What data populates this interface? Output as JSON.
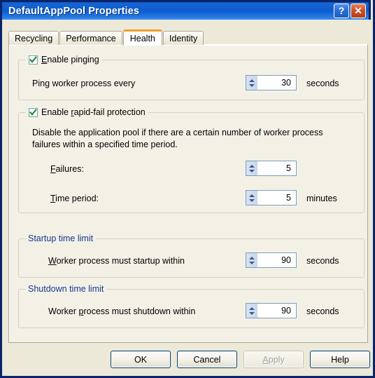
{
  "window": {
    "title": "DefaultAppPool Properties",
    "help_button": "?",
    "close_button": "✕"
  },
  "tabs": [
    {
      "label": "Recycling",
      "selected": false
    },
    {
      "label": "Performance",
      "selected": false
    },
    {
      "label": "Health",
      "selected": true
    },
    {
      "label": "Identity",
      "selected": false
    }
  ],
  "health": {
    "pinging": {
      "checkbox_label_pre": "E",
      "checkbox_label_accel": "E",
      "checkbox_label": "Enable pinging",
      "checked": true,
      "row_label": "Ping worker process every",
      "value": "30",
      "unit": "seconds"
    },
    "rapid_fail": {
      "checkbox_label": "Enable rapid-fail protection",
      "checked": true,
      "description": "Disable the application pool if there are a certain number of worker process failures within a specified time period.",
      "failures_label": "Failures:",
      "failures_value": "5",
      "time_period_label": "Time period:",
      "time_period_value": "5",
      "time_period_unit": "minutes"
    },
    "startup_limit": {
      "group_label": "Startup time limit",
      "row_label": "Worker process must startup within",
      "value": "90",
      "unit": "seconds"
    },
    "shutdown_limit": {
      "group_label": "Shutdown time limit",
      "row_label": "Worker process must shutdown within",
      "value": "90",
      "unit": "seconds"
    }
  },
  "buttons": {
    "ok": "OK",
    "cancel": "Cancel",
    "apply": "Apply",
    "help": "Help"
  },
  "colors": {
    "titlebar_blue": "#0e5ccd",
    "frame_border": "#0a246a",
    "dialog_face": "#ece9d8",
    "panel_face": "#f3f1e6",
    "group_label_blue": "#15388f",
    "tab_accent_orange": "#f0a030",
    "check_green": "#1a8f2a",
    "close_orange": "#d2512a"
  }
}
